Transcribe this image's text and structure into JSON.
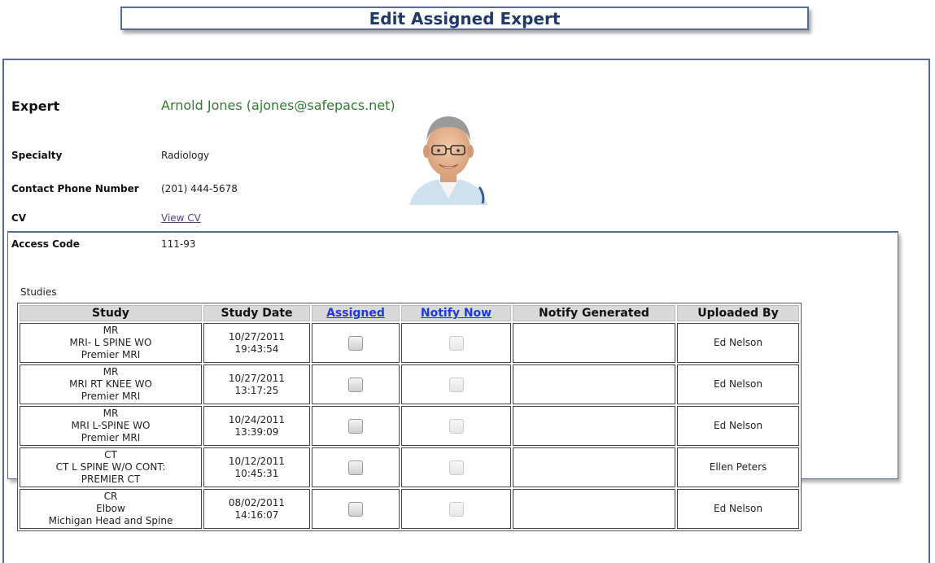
{
  "page": {
    "title": "Edit Assigned Expert"
  },
  "expert": {
    "label": "Expert",
    "value": "Arnold Jones (ajones@safepacs.net)",
    "specialty_label": "Specialty",
    "specialty": "Radiology",
    "phone_label": "Contact Phone Number",
    "phone": "(201) 444-5678",
    "cv_label": "CV",
    "cv_link": "View CV",
    "access_label": "Access Code",
    "access_code": "111-93"
  },
  "studies": {
    "legend": "Studies",
    "headers": {
      "study": "Study",
      "study_date": "Study Date",
      "assigned": "Assigned",
      "notify_now": "Notify Now",
      "notify_generated": "Notify Generated",
      "uploaded_by": "Uploaded By"
    },
    "rows": [
      {
        "modality": "MR",
        "desc": "MRI- L SPINE WO",
        "site": "Premier MRI",
        "date": "10/27/2011",
        "time": "19:43:54",
        "notify_generated": "",
        "uploaded_by": "Ed Nelson"
      },
      {
        "modality": "MR",
        "desc": "MRI RT KNEE WO",
        "site": "Premier MRI",
        "date": "10/27/2011",
        "time": "13:17:25",
        "notify_generated": "",
        "uploaded_by": "Ed Nelson"
      },
      {
        "modality": "MR",
        "desc": "MRI L-SPINE WO",
        "site": "Premier MRI",
        "date": "10/24/2011",
        "time": "13:39:09",
        "notify_generated": "",
        "uploaded_by": "Ed Nelson"
      },
      {
        "modality": "CT",
        "desc": "CT L SPINE W/O CONT:",
        "site": "PREMIER CT",
        "date": "10/12/2011",
        "time": "10:45:31",
        "notify_generated": "",
        "uploaded_by": "Ellen Peters"
      },
      {
        "modality": "CR",
        "desc": "Elbow",
        "site": "Michigan Head and Spine",
        "date": "08/02/2011",
        "time": "14:16:07",
        "notify_generated": "",
        "uploaded_by": "Ed Nelson"
      }
    ]
  }
}
